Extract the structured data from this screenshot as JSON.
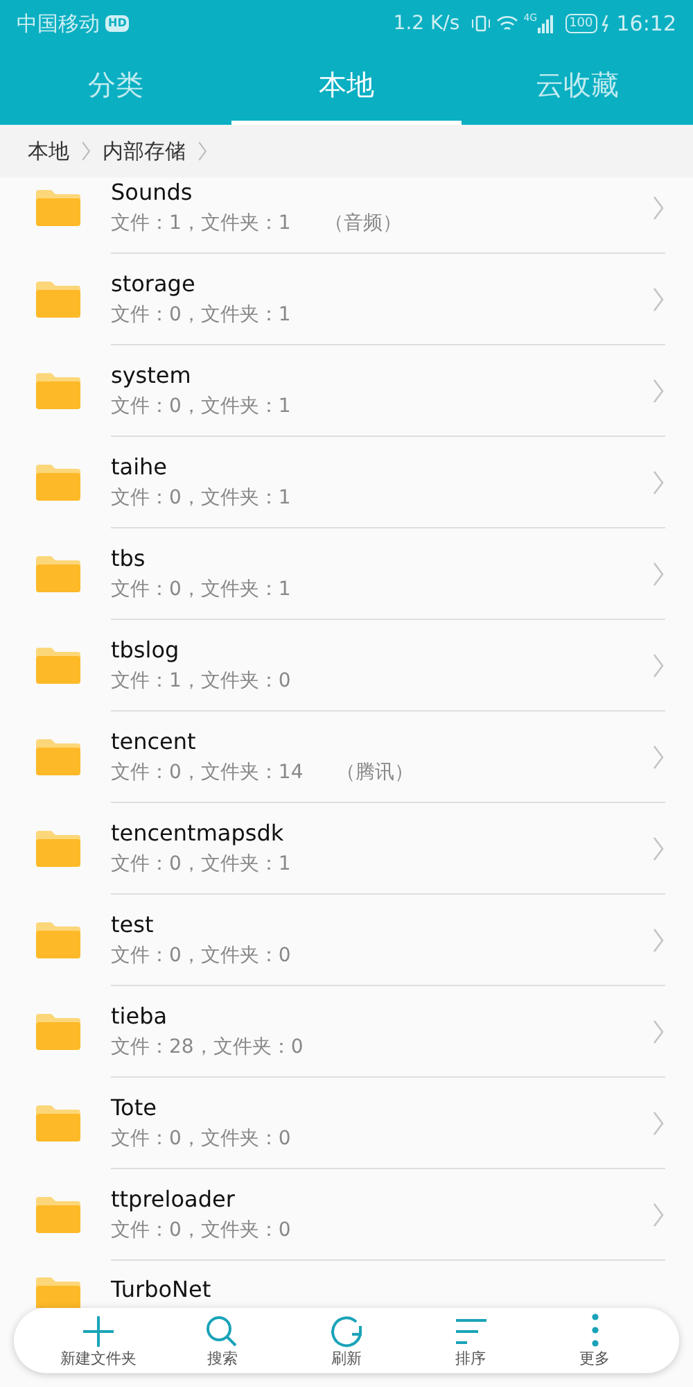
{
  "status_bar": {
    "carrier": "中国移动",
    "hd": "HD",
    "speed": "1.2 K/s",
    "network": "4G",
    "battery": "100",
    "time": "16:12"
  },
  "tabs": [
    {
      "label": "分类",
      "selected": false
    },
    {
      "label": "本地",
      "selected": true
    },
    {
      "label": "云收藏",
      "selected": false
    }
  ],
  "breadcrumb": [
    "本地",
    "内部存储"
  ],
  "folders": [
    {
      "name": "Sounds",
      "info": "文件：1，文件夹：1",
      "note": "（音频）"
    },
    {
      "name": "storage",
      "info": "文件：0，文件夹：1"
    },
    {
      "name": "system",
      "info": "文件：0，文件夹：1"
    },
    {
      "name": "taihe",
      "info": "文件：0，文件夹：1"
    },
    {
      "name": "tbs",
      "info": "文件：0，文件夹：1"
    },
    {
      "name": "tbslog",
      "info": "文件：1，文件夹：0"
    },
    {
      "name": "tencent",
      "info": "文件：0，文件夹：14",
      "note": "（腾讯）"
    },
    {
      "name": "tencentmapsdk",
      "info": "文件：0，文件夹：1"
    },
    {
      "name": "test",
      "info": "文件：0，文件夹：0"
    },
    {
      "name": "tieba",
      "info": "文件：28，文件夹：0"
    },
    {
      "name": "Tote",
      "info": "文件：0，文件夹：0"
    },
    {
      "name": "ttpreloader",
      "info": "文件：0，文件夹：0"
    },
    {
      "name": "TurboNet"
    }
  ],
  "toolbar": [
    {
      "kind": "new",
      "label": "新建文件夹"
    },
    {
      "kind": "search",
      "label": "搜索"
    },
    {
      "kind": "refresh",
      "label": "刷新"
    },
    {
      "kind": "sort",
      "label": "排序"
    },
    {
      "kind": "more",
      "label": "更多"
    }
  ]
}
